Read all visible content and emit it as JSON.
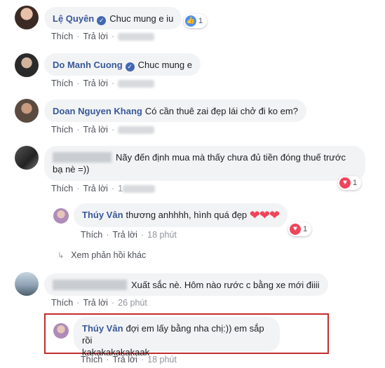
{
  "comments": [
    {
      "name": "Lệ Quyên",
      "text": "Chuc mung e iu",
      "like_label": "Thích",
      "reply_label": "Trả lời",
      "reaction_count": "1"
    },
    {
      "name": "Do Manh Cuong",
      "text": "Chuc mung e",
      "like_label": "Thích",
      "reply_label": "Trả lời"
    },
    {
      "name": "Doan Nguyen Khang",
      "text": "Có cần thuê zai đẹp lái chở đi ko em?",
      "like_label": "Thích",
      "reply_label": "Trả lời"
    },
    {
      "text": "Nãy đến định mua mà thấy chưa đủ tiền đóng thuế trước bạ nè =))",
      "like_label": "Thích",
      "reply_label": "Trả lời",
      "time": "1",
      "reaction_count": "1"
    }
  ],
  "reply1": {
    "name": "Thúy Vân",
    "text": "thương anhhhh, hình quá đẹp",
    "hearts": "❤❤❤",
    "like_label": "Thích",
    "reply_label": "Trả lời",
    "time": "18 phút",
    "reaction_count": "1"
  },
  "more_replies": "Xem phản hồi khác",
  "comment5": {
    "text": "Xuất sắc nè. Hôm nào rước c bằng xe mới điiii",
    "like_label": "Thích",
    "reply_label": "Trả lời",
    "time": "26 phút"
  },
  "reply2": {
    "name": "Thúy Vân",
    "text_line1": "đợi em lấy bằng nha chị:)) em sắp rồi",
    "text_line2": "kakakakakakaak",
    "like_label": "Thích",
    "reply_label": "Trả lời",
    "time": "18 phút"
  },
  "colors": {
    "name": "#385898",
    "bubble": "#f2f3f5",
    "highlight": "#c22d2d",
    "like": "#4e8ef7",
    "love": "#f0445b"
  }
}
